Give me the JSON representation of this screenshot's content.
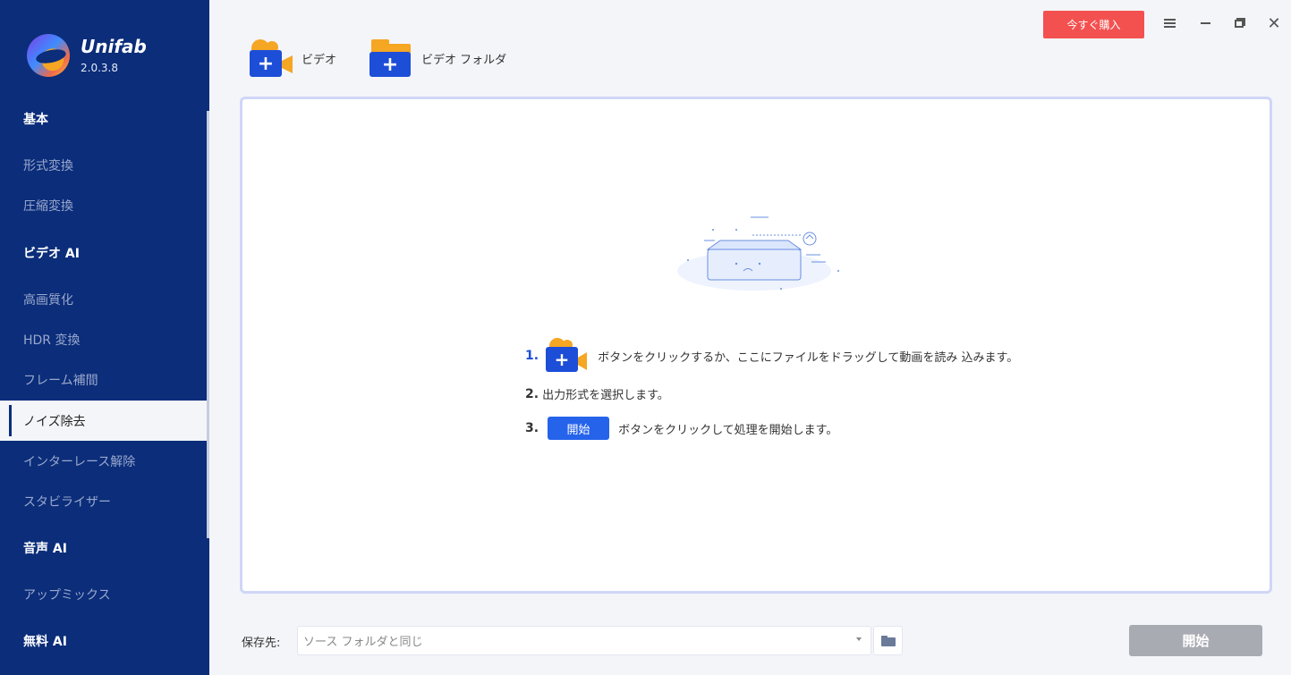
{
  "app": {
    "name": "Unifab",
    "version": "2.0.3.8"
  },
  "sidebar": {
    "items": [
      {
        "label": "基本",
        "type": "section"
      },
      {
        "label": "形式変換",
        "type": "item"
      },
      {
        "label": "圧縮変換",
        "type": "item"
      },
      {
        "label": "ビデオ AI",
        "type": "section"
      },
      {
        "label": "高画質化",
        "type": "item"
      },
      {
        "label": "HDR 変換",
        "type": "item"
      },
      {
        "label": "フレーム補間",
        "type": "item"
      },
      {
        "label": "ノイズ除去",
        "type": "active"
      },
      {
        "label": "インターレース解除",
        "type": "item"
      },
      {
        "label": "スタビライザー",
        "type": "item"
      },
      {
        "label": "音声 AI",
        "type": "section"
      },
      {
        "label": "アップミックス",
        "type": "item"
      },
      {
        "label": "無料 AI",
        "type": "section"
      }
    ]
  },
  "header": {
    "buy_label": "今すぐ購入",
    "icons": [
      "menu-icon",
      "minimize-icon",
      "restore-icon",
      "close-icon"
    ],
    "close_glyph": "✕"
  },
  "toolbar": {
    "video_label": "ビデオ",
    "folder_label": "ビデオ フォルダ",
    "plus": "+"
  },
  "instructions": {
    "step1_num": "1.",
    "step1_text": "ボタンをクリックするか、ここにファイルをドラッグして動画を読み 込みます。",
    "step2_num": "2.",
    "step2_text": "出力形式を選択します。",
    "step3_num": "3.",
    "step3_button": "開始",
    "step3_text": "ボタンをクリックして処理を開始します。"
  },
  "footer": {
    "save_label": "保存先:",
    "save_value": "ソース フォルダと同じ",
    "start_label": "開始"
  },
  "colors": {
    "sidebar_bg": "#0b2d7a",
    "accent_blue": "#1d4ed8",
    "buy_red": "#f35150",
    "camera_orange": "#f5a623",
    "start_disabled": "#a9abb2"
  }
}
